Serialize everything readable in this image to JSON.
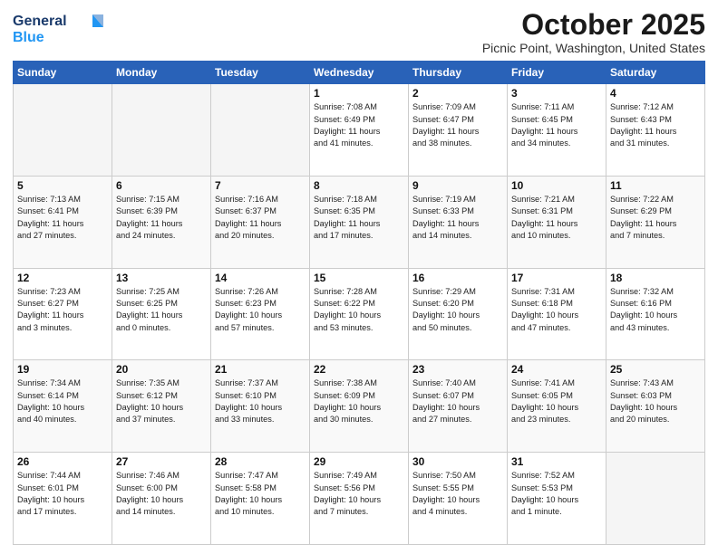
{
  "header": {
    "logo_line1": "General",
    "logo_line2": "Blue",
    "month": "October 2025",
    "location": "Picnic Point, Washington, United States"
  },
  "weekdays": [
    "Sunday",
    "Monday",
    "Tuesday",
    "Wednesday",
    "Thursday",
    "Friday",
    "Saturday"
  ],
  "weeks": [
    [
      {
        "day": "",
        "info": ""
      },
      {
        "day": "",
        "info": ""
      },
      {
        "day": "",
        "info": ""
      },
      {
        "day": "1",
        "info": "Sunrise: 7:08 AM\nSunset: 6:49 PM\nDaylight: 11 hours\nand 41 minutes."
      },
      {
        "day": "2",
        "info": "Sunrise: 7:09 AM\nSunset: 6:47 PM\nDaylight: 11 hours\nand 38 minutes."
      },
      {
        "day": "3",
        "info": "Sunrise: 7:11 AM\nSunset: 6:45 PM\nDaylight: 11 hours\nand 34 minutes."
      },
      {
        "day": "4",
        "info": "Sunrise: 7:12 AM\nSunset: 6:43 PM\nDaylight: 11 hours\nand 31 minutes."
      }
    ],
    [
      {
        "day": "5",
        "info": "Sunrise: 7:13 AM\nSunset: 6:41 PM\nDaylight: 11 hours\nand 27 minutes."
      },
      {
        "day": "6",
        "info": "Sunrise: 7:15 AM\nSunset: 6:39 PM\nDaylight: 11 hours\nand 24 minutes."
      },
      {
        "day": "7",
        "info": "Sunrise: 7:16 AM\nSunset: 6:37 PM\nDaylight: 11 hours\nand 20 minutes."
      },
      {
        "day": "8",
        "info": "Sunrise: 7:18 AM\nSunset: 6:35 PM\nDaylight: 11 hours\nand 17 minutes."
      },
      {
        "day": "9",
        "info": "Sunrise: 7:19 AM\nSunset: 6:33 PM\nDaylight: 11 hours\nand 14 minutes."
      },
      {
        "day": "10",
        "info": "Sunrise: 7:21 AM\nSunset: 6:31 PM\nDaylight: 11 hours\nand 10 minutes."
      },
      {
        "day": "11",
        "info": "Sunrise: 7:22 AM\nSunset: 6:29 PM\nDaylight: 11 hours\nand 7 minutes."
      }
    ],
    [
      {
        "day": "12",
        "info": "Sunrise: 7:23 AM\nSunset: 6:27 PM\nDaylight: 11 hours\nand 3 minutes."
      },
      {
        "day": "13",
        "info": "Sunrise: 7:25 AM\nSunset: 6:25 PM\nDaylight: 11 hours\nand 0 minutes."
      },
      {
        "day": "14",
        "info": "Sunrise: 7:26 AM\nSunset: 6:23 PM\nDaylight: 10 hours\nand 57 minutes."
      },
      {
        "day": "15",
        "info": "Sunrise: 7:28 AM\nSunset: 6:22 PM\nDaylight: 10 hours\nand 53 minutes."
      },
      {
        "day": "16",
        "info": "Sunrise: 7:29 AM\nSunset: 6:20 PM\nDaylight: 10 hours\nand 50 minutes."
      },
      {
        "day": "17",
        "info": "Sunrise: 7:31 AM\nSunset: 6:18 PM\nDaylight: 10 hours\nand 47 minutes."
      },
      {
        "day": "18",
        "info": "Sunrise: 7:32 AM\nSunset: 6:16 PM\nDaylight: 10 hours\nand 43 minutes."
      }
    ],
    [
      {
        "day": "19",
        "info": "Sunrise: 7:34 AM\nSunset: 6:14 PM\nDaylight: 10 hours\nand 40 minutes."
      },
      {
        "day": "20",
        "info": "Sunrise: 7:35 AM\nSunset: 6:12 PM\nDaylight: 10 hours\nand 37 minutes."
      },
      {
        "day": "21",
        "info": "Sunrise: 7:37 AM\nSunset: 6:10 PM\nDaylight: 10 hours\nand 33 minutes."
      },
      {
        "day": "22",
        "info": "Sunrise: 7:38 AM\nSunset: 6:09 PM\nDaylight: 10 hours\nand 30 minutes."
      },
      {
        "day": "23",
        "info": "Sunrise: 7:40 AM\nSunset: 6:07 PM\nDaylight: 10 hours\nand 27 minutes."
      },
      {
        "day": "24",
        "info": "Sunrise: 7:41 AM\nSunset: 6:05 PM\nDaylight: 10 hours\nand 23 minutes."
      },
      {
        "day": "25",
        "info": "Sunrise: 7:43 AM\nSunset: 6:03 PM\nDaylight: 10 hours\nand 20 minutes."
      }
    ],
    [
      {
        "day": "26",
        "info": "Sunrise: 7:44 AM\nSunset: 6:01 PM\nDaylight: 10 hours\nand 17 minutes."
      },
      {
        "day": "27",
        "info": "Sunrise: 7:46 AM\nSunset: 6:00 PM\nDaylight: 10 hours\nand 14 minutes."
      },
      {
        "day": "28",
        "info": "Sunrise: 7:47 AM\nSunset: 5:58 PM\nDaylight: 10 hours\nand 10 minutes."
      },
      {
        "day": "29",
        "info": "Sunrise: 7:49 AM\nSunset: 5:56 PM\nDaylight: 10 hours\nand 7 minutes."
      },
      {
        "day": "30",
        "info": "Sunrise: 7:50 AM\nSunset: 5:55 PM\nDaylight: 10 hours\nand 4 minutes."
      },
      {
        "day": "31",
        "info": "Sunrise: 7:52 AM\nSunset: 5:53 PM\nDaylight: 10 hours\nand 1 minute."
      },
      {
        "day": "",
        "info": ""
      }
    ]
  ]
}
